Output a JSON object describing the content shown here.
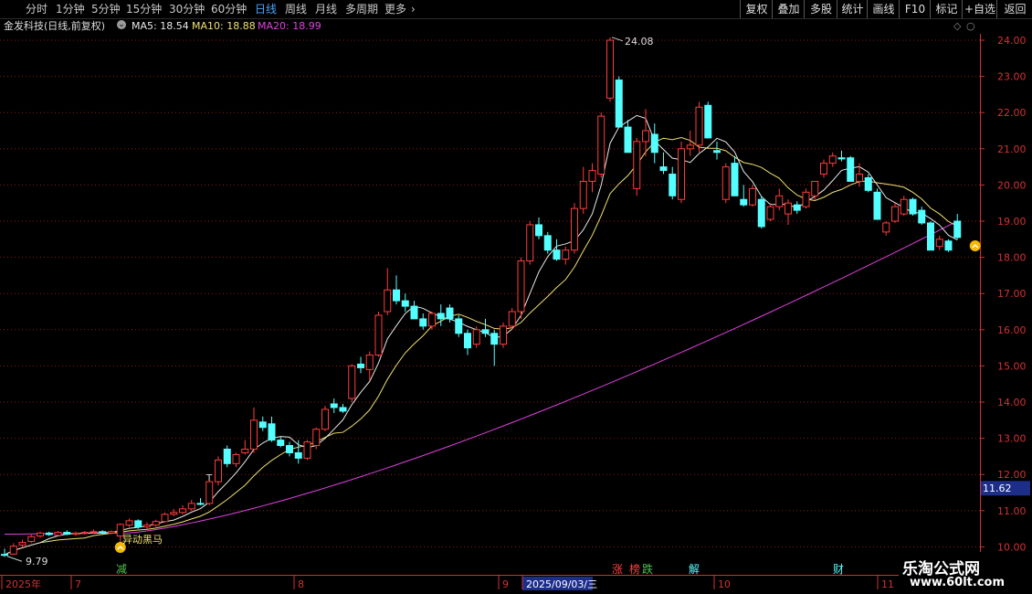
{
  "toolbar": {
    "periods": [
      "分时",
      "1分钟",
      "5分钟",
      "15分钟",
      "30分钟",
      "60分钟",
      "日线",
      "周线",
      "月线",
      "多周期",
      "更多"
    ],
    "active_period": "日线",
    "right_buttons": [
      "复权",
      "叠加",
      "多股",
      "统计",
      "画线",
      "F10",
      "标记",
      "+自选",
      "返回"
    ]
  },
  "info": {
    "stock": "金发科技(日线,前复权)",
    "ma5": "MA5: 18.54",
    "ma10": "MA10: 18.88",
    "ma20": "MA20: 18.99"
  },
  "colors": {
    "up": "#ff3c3c",
    "down": "#54ffff",
    "ma5": "#e8e8e8",
    "ma10": "#f0e070",
    "ma_long": "#e040e0",
    "grid": "#8a1a1a",
    "axis": "#d23232"
  },
  "chart_data": {
    "type": "candlestick",
    "y_ticks": [
      "24.00",
      "23.00",
      "22.00",
      "21.00",
      "20.00",
      "19.00",
      "18.00",
      "17.00",
      "16.00",
      "15.00",
      "14.00",
      "13.00",
      "12.00",
      "11.00",
      "10.00"
    ],
    "ylim": [
      9.5,
      24.5
    ],
    "current_price_tag": "11.62",
    "max_label": "24.08",
    "min_label": "9.79",
    "signal_label": "异动黑马",
    "x_labels": [
      "2025年",
      "7",
      "8",
      "9",
      "2025/09/03/三",
      "10",
      "11"
    ],
    "event_markers": [
      "减",
      "涨",
      "榜",
      "跌",
      "解",
      "财"
    ],
    "candles": [
      [
        9.79,
        9.95,
        9.72,
        9.78
      ],
      [
        9.8,
        10.1,
        9.78,
        10.02
      ],
      [
        10.05,
        10.2,
        9.98,
        10.12
      ],
      [
        10.15,
        10.34,
        10.1,
        10.28
      ],
      [
        10.3,
        10.42,
        10.25,
        10.38
      ],
      [
        10.38,
        10.42,
        10.3,
        10.34
      ],
      [
        10.32,
        10.44,
        10.3,
        10.4
      ],
      [
        10.4,
        10.46,
        10.32,
        10.35
      ],
      [
        10.35,
        10.42,
        10.3,
        10.38
      ],
      [
        10.38,
        10.44,
        10.34,
        10.4
      ],
      [
        10.4,
        10.48,
        10.36,
        10.42
      ],
      [
        10.42,
        10.46,
        10.35,
        10.38
      ],
      [
        10.38,
        10.45,
        10.35,
        10.42
      ],
      [
        10.3,
        10.65,
        10.1,
        10.62
      ],
      [
        10.6,
        10.78,
        10.55,
        10.72
      ],
      [
        10.72,
        10.76,
        10.5,
        10.55
      ],
      [
        10.55,
        10.68,
        10.5,
        10.6
      ],
      [
        10.6,
        10.75,
        10.55,
        10.7
      ],
      [
        10.7,
        10.95,
        10.68,
        10.9
      ],
      [
        10.9,
        11.05,
        10.85,
        10.95
      ],
      [
        10.95,
        11.15,
        10.9,
        11.05
      ],
      [
        11.05,
        11.3,
        11.0,
        11.2
      ],
      [
        11.2,
        11.35,
        11.15,
        11.18
      ],
      [
        11.2,
        11.85,
        11.15,
        11.8
      ],
      [
        11.8,
        12.5,
        11.7,
        12.4
      ],
      [
        12.7,
        12.8,
        12.2,
        12.3
      ],
      [
        12.3,
        12.6,
        12.2,
        12.55
      ],
      [
        12.6,
        12.95,
        12.55,
        12.7
      ],
      [
        12.7,
        13.85,
        12.6,
        13.5
      ],
      [
        13.45,
        13.6,
        13.2,
        13.3
      ],
      [
        13.4,
        13.6,
        12.9,
        12.95
      ],
      [
        12.95,
        13.05,
        12.75,
        12.8
      ],
      [
        12.8,
        12.9,
        12.5,
        12.6
      ],
      [
        12.6,
        12.95,
        12.3,
        12.45
      ],
      [
        12.45,
        12.95,
        12.4,
        12.9
      ],
      [
        12.8,
        13.3,
        12.7,
        13.25
      ],
      [
        13.25,
        13.9,
        13.2,
        13.8
      ],
      [
        13.95,
        14.1,
        13.7,
        13.85
      ],
      [
        13.85,
        13.95,
        13.7,
        13.75
      ],
      [
        14.1,
        15.05,
        14.0,
        15.0
      ],
      [
        15.05,
        15.25,
        14.8,
        14.95
      ],
      [
        14.9,
        15.4,
        14.6,
        15.3
      ],
      [
        15.3,
        16.5,
        15.25,
        16.4
      ],
      [
        16.5,
        17.7,
        16.4,
        17.1
      ],
      [
        17.1,
        17.5,
        16.7,
        16.8
      ],
      [
        16.8,
        17.0,
        16.5,
        16.65
      ],
      [
        16.65,
        16.8,
        16.3,
        16.3
      ],
      [
        16.3,
        16.45,
        16.0,
        16.1
      ],
      [
        16.1,
        16.5,
        16.0,
        16.45
      ],
      [
        16.45,
        16.7,
        16.1,
        16.3
      ],
      [
        16.6,
        16.7,
        16.2,
        16.3
      ],
      [
        16.3,
        16.4,
        15.8,
        15.9
      ],
      [
        15.9,
        16.0,
        15.3,
        15.5
      ],
      [
        15.6,
        16.1,
        15.5,
        16.0
      ],
      [
        16.0,
        16.3,
        15.8,
        15.9
      ],
      [
        15.9,
        16.0,
        15.0,
        15.6
      ],
      [
        15.6,
        16.2,
        15.5,
        16.1
      ],
      [
        16.1,
        16.6,
        16.0,
        16.5
      ],
      [
        16.5,
        18.0,
        16.3,
        17.9
      ],
      [
        17.9,
        19.0,
        17.8,
        18.9
      ],
      [
        18.9,
        19.1,
        18.5,
        18.6
      ],
      [
        18.6,
        18.7,
        18.1,
        18.2
      ],
      [
        18.2,
        18.5,
        17.9,
        17.95
      ],
      [
        17.95,
        18.3,
        17.8,
        18.2
      ],
      [
        18.2,
        19.5,
        18.1,
        19.35
      ],
      [
        19.35,
        20.5,
        19.2,
        20.1
      ],
      [
        20.1,
        20.6,
        19.8,
        20.4
      ],
      [
        20.3,
        22.0,
        20.2,
        21.9
      ],
      [
        22.4,
        24.08,
        22.3,
        24.0
      ],
      [
        22.9,
        23.0,
        21.6,
        21.6
      ],
      [
        21.6,
        21.8,
        20.9,
        20.9
      ],
      [
        19.9,
        21.3,
        19.7,
        21.2
      ],
      [
        21.2,
        22.1,
        20.8,
        21.5
      ],
      [
        21.4,
        21.7,
        20.6,
        20.9
      ],
      [
        20.5,
        20.9,
        20.3,
        20.4
      ],
      [
        20.3,
        20.5,
        19.6,
        19.7
      ],
      [
        19.6,
        21.2,
        19.5,
        21.0
      ],
      [
        21.0,
        21.5,
        20.8,
        21.1
      ],
      [
        21.1,
        22.3,
        20.9,
        22.15
      ],
      [
        22.2,
        22.3,
        21.3,
        21.3
      ],
      [
        20.95,
        21.2,
        20.7,
        20.9
      ],
      [
        19.6,
        20.6,
        19.5,
        20.5
      ],
      [
        20.6,
        20.8,
        19.7,
        19.7
      ],
      [
        19.6,
        20.0,
        19.4,
        19.45
      ],
      [
        19.45,
        20.0,
        19.4,
        19.9
      ],
      [
        19.6,
        19.7,
        18.8,
        18.85
      ],
      [
        19.05,
        19.5,
        19.0,
        19.4
      ],
      [
        19.4,
        19.9,
        19.3,
        19.7
      ],
      [
        19.2,
        19.6,
        18.9,
        19.5
      ],
      [
        19.45,
        19.55,
        19.2,
        19.3
      ],
      [
        19.4,
        19.9,
        19.35,
        19.8
      ],
      [
        19.7,
        20.1,
        19.6,
        20.1
      ],
      [
        20.3,
        20.7,
        20.2,
        20.6
      ],
      [
        20.6,
        20.9,
        20.5,
        20.8
      ],
      [
        20.75,
        20.95,
        20.65,
        20.72
      ],
      [
        20.75,
        20.8,
        20.1,
        20.1
      ],
      [
        20.1,
        20.6,
        19.95,
        20.3
      ],
      [
        20.2,
        20.3,
        19.8,
        19.85
      ],
      [
        19.8,
        19.9,
        19.05,
        19.05
      ],
      [
        18.7,
        19.0,
        18.6,
        18.95
      ],
      [
        19.0,
        19.5,
        18.95,
        19.4
      ],
      [
        19.2,
        19.7,
        19.15,
        19.6
      ],
      [
        19.6,
        19.65,
        19.15,
        19.2
      ],
      [
        19.3,
        19.4,
        18.9,
        18.95
      ],
      [
        18.95,
        19.0,
        18.2,
        18.2
      ],
      [
        18.3,
        18.6,
        18.2,
        18.5
      ],
      [
        18.45,
        18.5,
        18.15,
        18.2
      ],
      [
        19.0,
        19.2,
        18.5,
        18.55
      ]
    ]
  }
}
